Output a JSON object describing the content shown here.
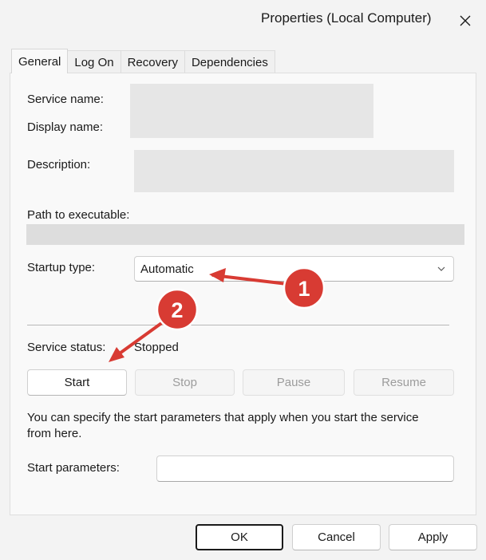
{
  "window": {
    "title": "Properties (Local Computer)",
    "close_glyph": "✕"
  },
  "tabs": [
    {
      "label": "General",
      "active": true
    },
    {
      "label": "Log On",
      "active": false
    },
    {
      "label": "Recovery",
      "active": false
    },
    {
      "label": "Dependencies",
      "active": false
    }
  ],
  "general": {
    "service_name_label": "Service name:",
    "display_name_label": "Display name:",
    "description_label": "Description:",
    "path_label": "Path to executable:",
    "startup_type_label": "Startup type:",
    "startup_type_value": "Automatic",
    "service_status_label": "Service status:",
    "service_status_value": "Stopped",
    "buttons": {
      "start": "Start",
      "stop": "Stop",
      "pause": "Pause",
      "resume": "Resume"
    },
    "hint_line1": "You can specify the start parameters that apply when you start the service",
    "hint_line2": "from here.",
    "start_params_label": "Start parameters:",
    "start_params_value": ""
  },
  "footer": {
    "ok": "OK",
    "cancel": "Cancel",
    "apply": "Apply"
  },
  "annotations": {
    "badge1": "1",
    "badge2": "2",
    "color": "#d83b33"
  }
}
